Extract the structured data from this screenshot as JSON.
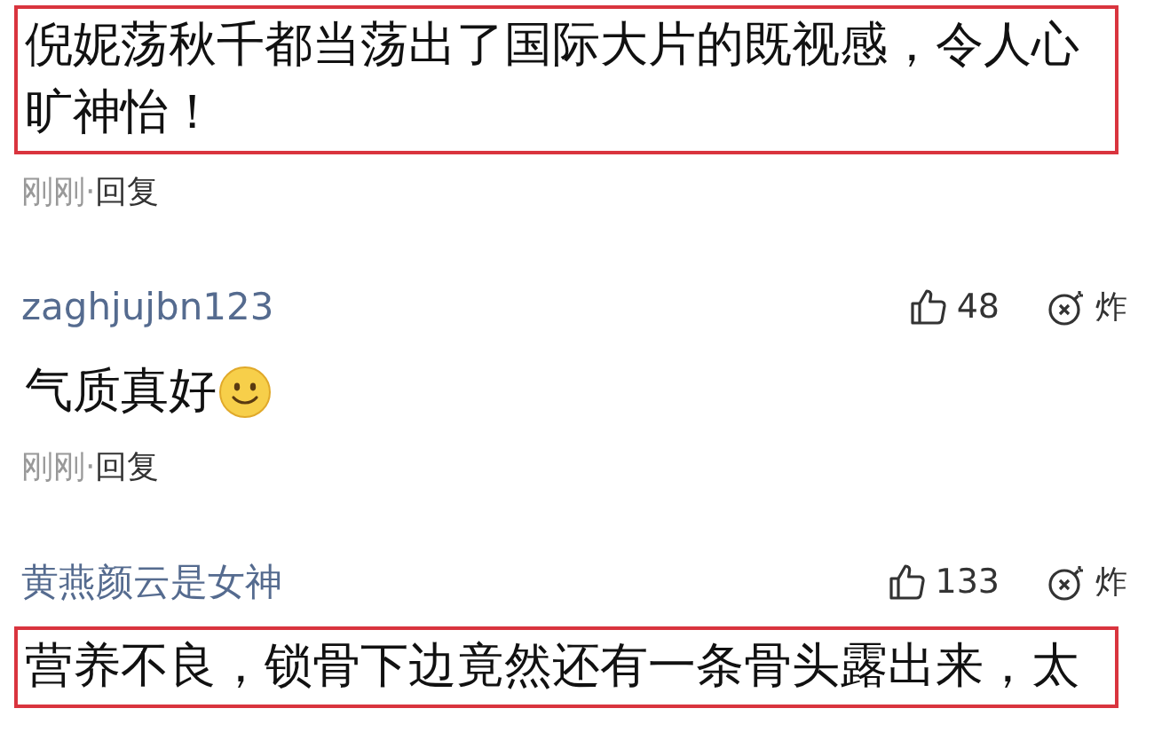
{
  "comments": [
    {
      "text": "倪妮荡秋千都当荡出了国际大片的既视感，令人心旷神怡！",
      "highlighted": true,
      "has_emoji": false,
      "time": "刚刚",
      "separator": "·",
      "reply": "回复"
    },
    {
      "author": "zaghjujbn123",
      "likes": "48",
      "bomb": "炸",
      "text": "气质真好",
      "highlighted": false,
      "has_emoji": true,
      "time": "刚刚",
      "separator": "·",
      "reply": "回复"
    },
    {
      "author": "黄燕颜云是女神",
      "likes": "133",
      "bomb": "炸",
      "text": "营养不良，锁骨下边竟然还有一条骨头露出来，太",
      "highlighted": true,
      "has_emoji": false
    }
  ]
}
